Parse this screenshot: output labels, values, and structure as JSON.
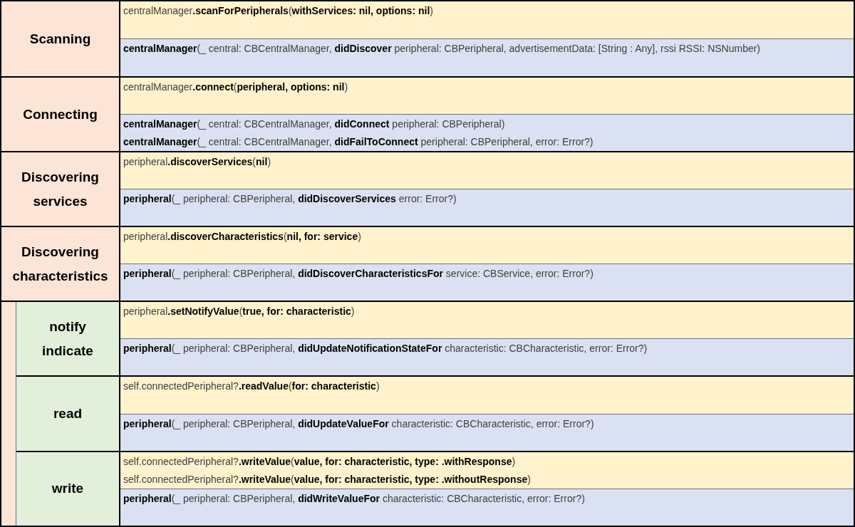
{
  "sections": [
    {
      "kind": "main",
      "label": "Scanning",
      "calls": [
        "centralManager**.scanForPeripherals**(**withServices: nil, options: nil**)"
      ],
      "delegates": [
        "**centralManager**(_ central: CBCentralManager, **didDiscover** peripheral: CBPeripheral, advertisementData: [String : Any], rssi RSSI: NSNumber)"
      ]
    },
    {
      "kind": "main",
      "label": "Connecting",
      "calls": [
        "centralManager**.connect**(**peripheral, options: nil**)"
      ],
      "delegates": [
        "**centralManager**(_ central: CBCentralManager, **didConnect** peripheral: CBPeripheral)",
        "**centralManager**(_ central: CBCentralManager, **didFailToConnect** peripheral: CBPeripheral, error: Error?)"
      ]
    },
    {
      "kind": "main",
      "label": "Discovering\nservices",
      "calls": [
        "peripheral**.discoverServices**(**nil**)"
      ],
      "delegates": [
        "**peripheral**(_ peripheral: CBPeripheral, **didDiscoverServices** error: Error?)"
      ]
    },
    {
      "kind": "main",
      "label": "Discovering\ncharacteristics",
      "calls": [
        "peripheral**.discoverCharacteristics**(**nil, for: service**)"
      ],
      "delegates": [
        "**peripheral**(_ peripheral: CBPeripheral, **didDiscoverCharacteristicsFor** service: CBService, error: Error?)"
      ]
    },
    {
      "kind": "sub",
      "label": "notify\nindicate",
      "calls": [
        "peripheral**.setNotifyValue**(**true, for: characteristic**)"
      ],
      "delegates": [
        "**peripheral**(_ peripheral: CBPeripheral, **didUpdateNotificationStateFor** characteristic: CBCharacteristic, error: Error?)"
      ]
    },
    {
      "kind": "sub",
      "label": "read",
      "calls": [
        "self.connectedPeripheral?**.readValue**(**for: characteristic**)"
      ],
      "delegates": [
        "**peripheral**(_ peripheral: CBPeripheral, **didUpdateValueFor** characteristic: CBCharacteristic, error: Error?)"
      ]
    },
    {
      "kind": "sub",
      "label": "write",
      "calls": [
        "self.connectedPeripheral?**.writeValue**(**value, for: characteristic, type: .withResponse**)",
        "self.connectedPeripheral?**.writeValue**(**value, for: characteristic, type: .withoutResponse**)"
      ],
      "delegates": [
        "**peripheral**(_ peripheral: CBPeripheral, **didWriteValueFor** characteristic: CBCharacteristic, error: Error?)"
      ]
    }
  ]
}
